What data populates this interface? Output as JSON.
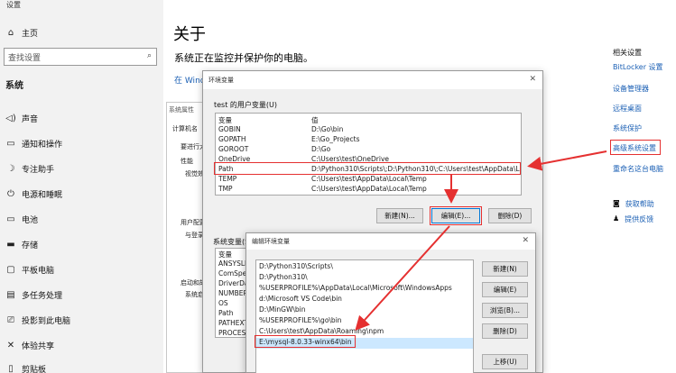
{
  "window_title": "设置",
  "sidebar": {
    "home": "主页",
    "search_placeholder": "查找设置",
    "section": "系统",
    "items": [
      {
        "icon": "speaker-icon",
        "label": "声音"
      },
      {
        "icon": "notification-icon",
        "label": "通知和操作"
      },
      {
        "icon": "moon-icon",
        "label": "专注助手"
      },
      {
        "icon": "power-icon",
        "label": "电源和睡眠"
      },
      {
        "icon": "battery-icon",
        "label": "电池"
      },
      {
        "icon": "storage-icon",
        "label": "存储"
      },
      {
        "icon": "tablet-icon",
        "label": "平板电脑"
      },
      {
        "icon": "multitask-icon",
        "label": "多任务处理"
      },
      {
        "icon": "project-icon",
        "label": "投影到此电脑"
      },
      {
        "icon": "share-icon",
        "label": "体验共享"
      },
      {
        "icon": "clipboard-icon",
        "label": "剪贴板"
      }
    ]
  },
  "main": {
    "title": "关于",
    "subtitle": "系统正在监控并保护你的电脑。",
    "link": "在 Windo"
  },
  "related": {
    "heading": "相关设置",
    "links": [
      "BitLocker 设置",
      "设备管理器",
      "远程桌面",
      "系统保护",
      "高级系统设置",
      "重命名这台电脑"
    ],
    "help": [
      {
        "icon": "help-icon",
        "label": "获取帮助"
      },
      {
        "icon": "feedback-icon",
        "label": "提供反馈"
      }
    ]
  },
  "sysprops": {
    "title": "系统属性",
    "lines": [
      "计算机名",
      "要进行大",
      "性能",
      "视觉效",
      "用户配置",
      "与登录",
      "启动和故",
      "系统启"
    ]
  },
  "env_dialog": {
    "title": "环境变量",
    "user_group": "test 的用户变量(U)",
    "columns": [
      "变量",
      "值"
    ],
    "user_vars": [
      {
        "name": "GOBIN",
        "value": "D:\\Go\\bin"
      },
      {
        "name": "GOPATH",
        "value": "E:\\Go_Projects"
      },
      {
        "name": "GOROOT",
        "value": "D:\\Go"
      },
      {
        "name": "OneDrive",
        "value": "C:\\Users\\test\\OneDrive"
      },
      {
        "name": "Path",
        "value": "D:\\Python310\\Scripts\\;D:\\Python310\\;C:\\Users\\test\\AppData\\Local..."
      },
      {
        "name": "TEMP",
        "value": "C:\\Users\\test\\AppData\\Local\\Temp"
      },
      {
        "name": "TMP",
        "value": "C:\\Users\\test\\AppData\\Local\\Temp"
      }
    ],
    "buttons": {
      "new": "新建(N)...",
      "edit": "编辑(E)...",
      "delete": "删除(D)"
    },
    "system_group": "系统变量(S)",
    "system_vars": [
      "变量",
      "ANSYSLI",
      "ComSpe",
      "DriverDa",
      "NUMBER",
      "OS",
      "Path",
      "PATHEXT",
      "PROCESS"
    ]
  },
  "edit_dialog": {
    "title": "编辑环境变量",
    "entries": [
      "D:\\Python310\\Scripts\\",
      "D:\\Python310\\",
      "%USERPROFILE%\\AppData\\Local\\Microsoft\\WindowsApps",
      "d:\\Microsoft VS Code\\bin",
      "D:\\MinGW\\bin",
      "%USERPROFILE%\\go\\bin",
      "C:\\Users\\test\\AppData\\Roaming\\npm",
      "E:\\mysql-8.0.33-winx64\\bin"
    ],
    "buttons": {
      "new": "新建(N)",
      "edit": "编辑(E)",
      "browse": "浏览(B)...",
      "delete": "删除(D)",
      "up": "上移(U)"
    }
  },
  "colors": {
    "accent": "#1a5fb4",
    "highlight": "#e53030",
    "selection": "#cce8ff"
  }
}
